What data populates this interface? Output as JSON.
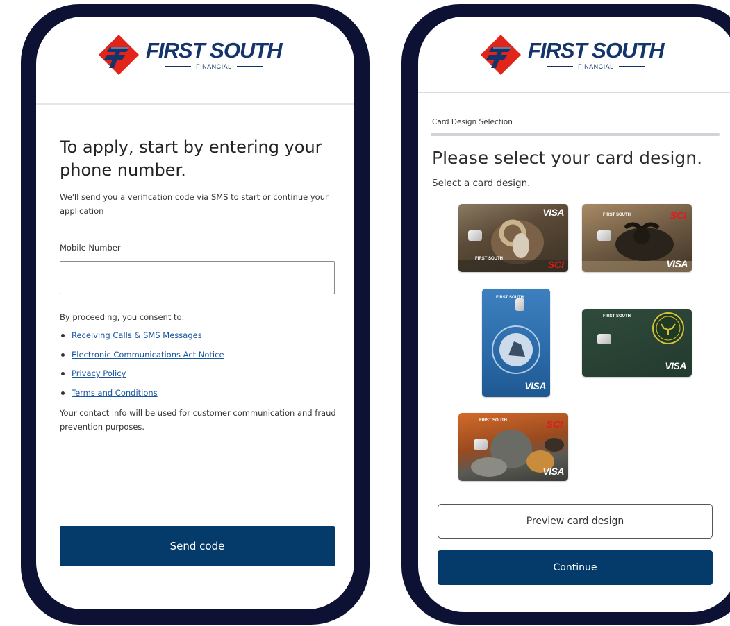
{
  "screen1": {
    "brand": {
      "name": "FIRST SOUTH",
      "sub": "FINANCIAL",
      "icon": "first-south-logo-icon"
    },
    "heading": "To apply, start by entering your phone number.",
    "description": "We'll send you a verification code via SMS to start or continue your application",
    "mobile_label": "Mobile Number",
    "mobile_value": "",
    "consent_intro": "By proceeding, you consent to:",
    "links": [
      "Receiving Calls & SMS Messages",
      "Electronic Communications Act Notice",
      "Privacy Policy",
      "Terms and Conditions"
    ],
    "note": "Your contact info will be used for customer communication and fraud prevention purposes.",
    "send_button": "Send code"
  },
  "screen2": {
    "brand": {
      "name": "FIRST SOUTH",
      "sub": "FINANCIAL",
      "icon": "first-south-logo-icon"
    },
    "step_label": "Card Design Selection",
    "progress": 1.0,
    "heading": "Please select your card design.",
    "subheading": "Select a card design.",
    "cards": [
      {
        "visa": "VISA",
        "sci": "SCI",
        "brand": "FIRST SOUTH",
        "subject": "bighorn-sheep"
      },
      {
        "visa": "VISA",
        "sci": "SCI",
        "brand": "FIRST SOUTH",
        "subject": "cape-buffalo"
      },
      {
        "visa": "VISA",
        "brand": "FIRST SOUTH",
        "subject": "safari-club-seal"
      },
      {
        "visa": "VISA",
        "brand": "FIRST SOUTH",
        "subject": "deer-emblem"
      },
      {
        "visa": "VISA",
        "sci": "SCI",
        "brand": "FIRST SOUTH",
        "subject": "big-five-animals"
      }
    ],
    "preview_button": "Preview card design",
    "continue_button": "Continue"
  },
  "colors": {
    "frame": "#0d1133",
    "primary": "#053b6b",
    "brand_blue": "#14356b",
    "brand_red": "#e1251b",
    "link": "#1a55a0"
  }
}
